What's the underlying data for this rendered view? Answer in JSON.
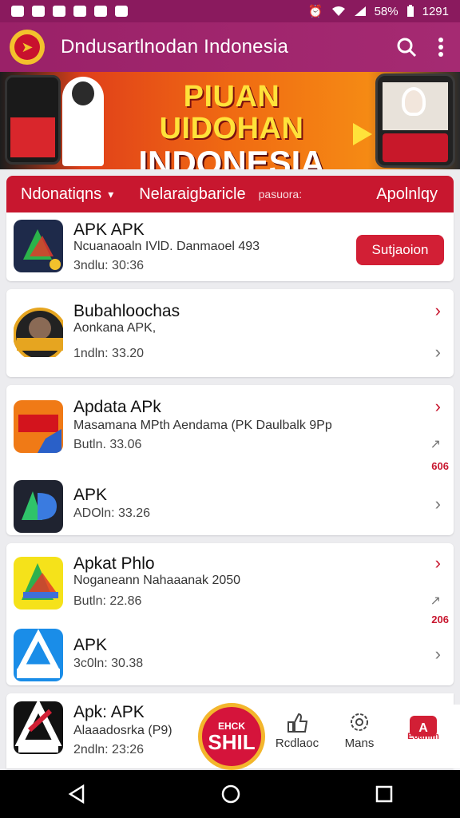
{
  "status_bar": {
    "battery": "58%",
    "time": "1291"
  },
  "app_bar": {
    "title": "Dndusartlnodan Indonesia"
  },
  "banner": {
    "headline_line1": "PIUAN UIDOHAN",
    "headline_line2": "INDONESIA"
  },
  "tabs": [
    {
      "label": "Ndonatiqns"
    },
    {
      "label": "Nelaraigbaricle"
    },
    {
      "label": "pasuora:"
    },
    {
      "label": "Apolnlqy"
    }
  ],
  "apps": [
    {
      "name": "APK APK",
      "desc": "Ncuanaoaln IVlD. Danmaoel 493",
      "meta": "3ndlu: 30:36",
      "cta": "Sutjaoion"
    },
    {
      "name": "Bubahloochas",
      "desc": "Aonkana APK,",
      "meta": "1ndln: 33.20"
    },
    {
      "name": "Apdata APk",
      "desc": "Masamana MPth Aendama (PK Daulbalk 9Pp",
      "meta": "Butln. 33.06",
      "badge": "606"
    },
    {
      "name": "APK",
      "desc": "",
      "meta": "ADOln: 33.26"
    },
    {
      "name": "Apkat Phlo",
      "desc": "Noganeann Nahaaanak 2050",
      "meta": "Butln: 22.86",
      "badge": "206"
    },
    {
      "name": "APK",
      "desc": "",
      "meta": "3c0ln: 30.38"
    },
    {
      "name": "Apk: APK",
      "desc": "Alaaadosrka (P9)",
      "meta": "2ndln: 23:26"
    }
  ],
  "fab": {
    "line1": "EHCK",
    "line2": "SHIL"
  },
  "bottom_nav": [
    {
      "label": "Rcdlaoc",
      "icon": "thumb-icon"
    },
    {
      "label": "Mans",
      "icon": "gear-icon"
    },
    {
      "label": "Eoanim",
      "icon": "store-icon"
    }
  ],
  "colors": {
    "primary": "#9a2168",
    "accent": "#c8172f",
    "highlight": "#f3b62c"
  }
}
